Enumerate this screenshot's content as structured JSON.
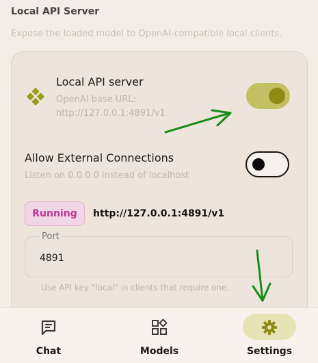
{
  "section": {
    "title": "Local API Server",
    "description": "Expose the loaded model to OpenAI-compatible local clients."
  },
  "api_server": {
    "title": "Local API server",
    "subtitle": "OpenAI base URL: http://127.0.0.1:4891/v1",
    "enabled": true
  },
  "external": {
    "title": "Allow External Connections",
    "subtitle": "Listen on 0.0.0.0 instead of localhost",
    "enabled": false
  },
  "status": {
    "badge": "Running",
    "url": "http://127.0.0.1:4891/v1"
  },
  "port": {
    "label": "Port",
    "value": "4891"
  },
  "hint": "Use API key \"local\" in clients that require one.",
  "nav": {
    "chat": "Chat",
    "models": "Models",
    "settings": "Settings",
    "active": "settings"
  },
  "colors": {
    "accent": "#8d8c16",
    "toggle_on_track": "#c2c063",
    "running_badge_text": "#b63a90",
    "running_badge_bg": "#f1d6e6",
    "annotation_arrow": "#1a8a1a"
  },
  "icons": {
    "api": "diamond-grid-icon",
    "chat": "chat-bubble-icon",
    "models": "models-grid-icon",
    "settings": "gear-icon"
  }
}
